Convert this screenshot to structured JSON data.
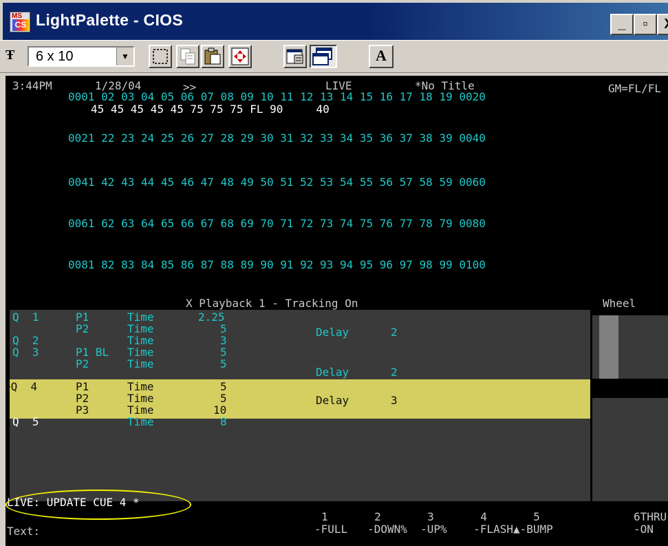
{
  "window": {
    "title": "LightPalette - CIOS",
    "icon_top": "MS",
    "icon_bottom": "CS",
    "controls": [
      "_",
      "▫",
      "X"
    ]
  },
  "toolbar": {
    "font_size_value": "6 x 10",
    "font_glyph": "Ŧ",
    "letter_button": "A"
  },
  "header": {
    "time": "3:44PM",
    "date": "1/28/04",
    "arrows": ">>",
    "mode": "LIVE",
    "show_title": "*No Title",
    "gm": "GM=FL/FL"
  },
  "channels": {
    "row1": "0001 02 03 04 05 06 07 08 09 10 11 12 13 14 15 16 17 18 19 0020",
    "levels1": "45 45 45 45 45 75 75 75 FL 90     40",
    "row2": "0021 22 23 24 25 26 27 28 29 30 31 32 33 34 35 36 37 38 39 0040",
    "row3": "0041 42 43 44 45 46 47 48 49 50 51 52 53 54 55 56 57 58 59 0060",
    "row4": "0061 62 63 64 65 66 67 68 69 70 71 72 73 74 75 76 77 78 79 0080",
    "row5": "0081 82 83 84 85 86 87 88 89 90 91 92 93 94 95 96 97 98 99 0100"
  },
  "playback": {
    "header": "X Playback 1 - Tracking On",
    "wheel_label": "Wheel",
    "rows": [
      {
        "cue": "Q  1",
        "part": "P1",
        "label": "Time",
        "value": "2.25",
        "delay_label": "",
        "delay_value": ""
      },
      {
        "cue": "",
        "part": "P2",
        "label": "Time",
        "value": "5",
        "delay_label": "Delay",
        "delay_value": "2"
      },
      {
        "cue": "Q  2",
        "part": "",
        "label": "Time",
        "value": "3",
        "delay_label": "",
        "delay_value": ""
      },
      {
        "cue": "Q  3",
        "part": "P1 BL",
        "label": "Time",
        "value": "5",
        "delay_label": "",
        "delay_value": ""
      },
      {
        "cue": "",
        "part": "P2",
        "label": "Time",
        "value": "5",
        "delay_label": "Delay",
        "delay_value": "2"
      },
      {
        "cue": ">Q  4",
        "part": "P1",
        "label": "Time",
        "value": "5",
        "delay_label": "",
        "delay_value": ""
      },
      {
        "cue": "",
        "part": "P2",
        "label": "Time",
        "value": "5",
        "delay_label": "Delay",
        "delay_value": "3"
      },
      {
        "cue": "",
        "part": "P3",
        "label": "Time",
        "value": "10",
        "delay_label": "",
        "delay_value": ""
      },
      {
        "cue": "Q  5",
        "part": "",
        "label": "Time",
        "value": "8",
        "delay_label": "",
        "delay_value": ""
      }
    ]
  },
  "command_line": {
    "text": "LIVE: UPDATE CUE 4 *",
    "prompt": "Text:"
  },
  "softkeys": {
    "numbers": "1       2       3       4       5",
    "labels": "-FULL   -DOWN%  -UP%    -FLASH▲-BUMP",
    "key6_number": "6THRU",
    "key6_label": "-ON"
  },
  "colors": {
    "screen_bg": "#000000",
    "channel_cyan": "#1ec8c8",
    "level_white": "#ffffff",
    "selected_cue_bg": "#d4cf60",
    "playback_bg": "#3a3a3a",
    "annotation_ellipse": "#f0f000",
    "titlebar": "#0a246a"
  }
}
